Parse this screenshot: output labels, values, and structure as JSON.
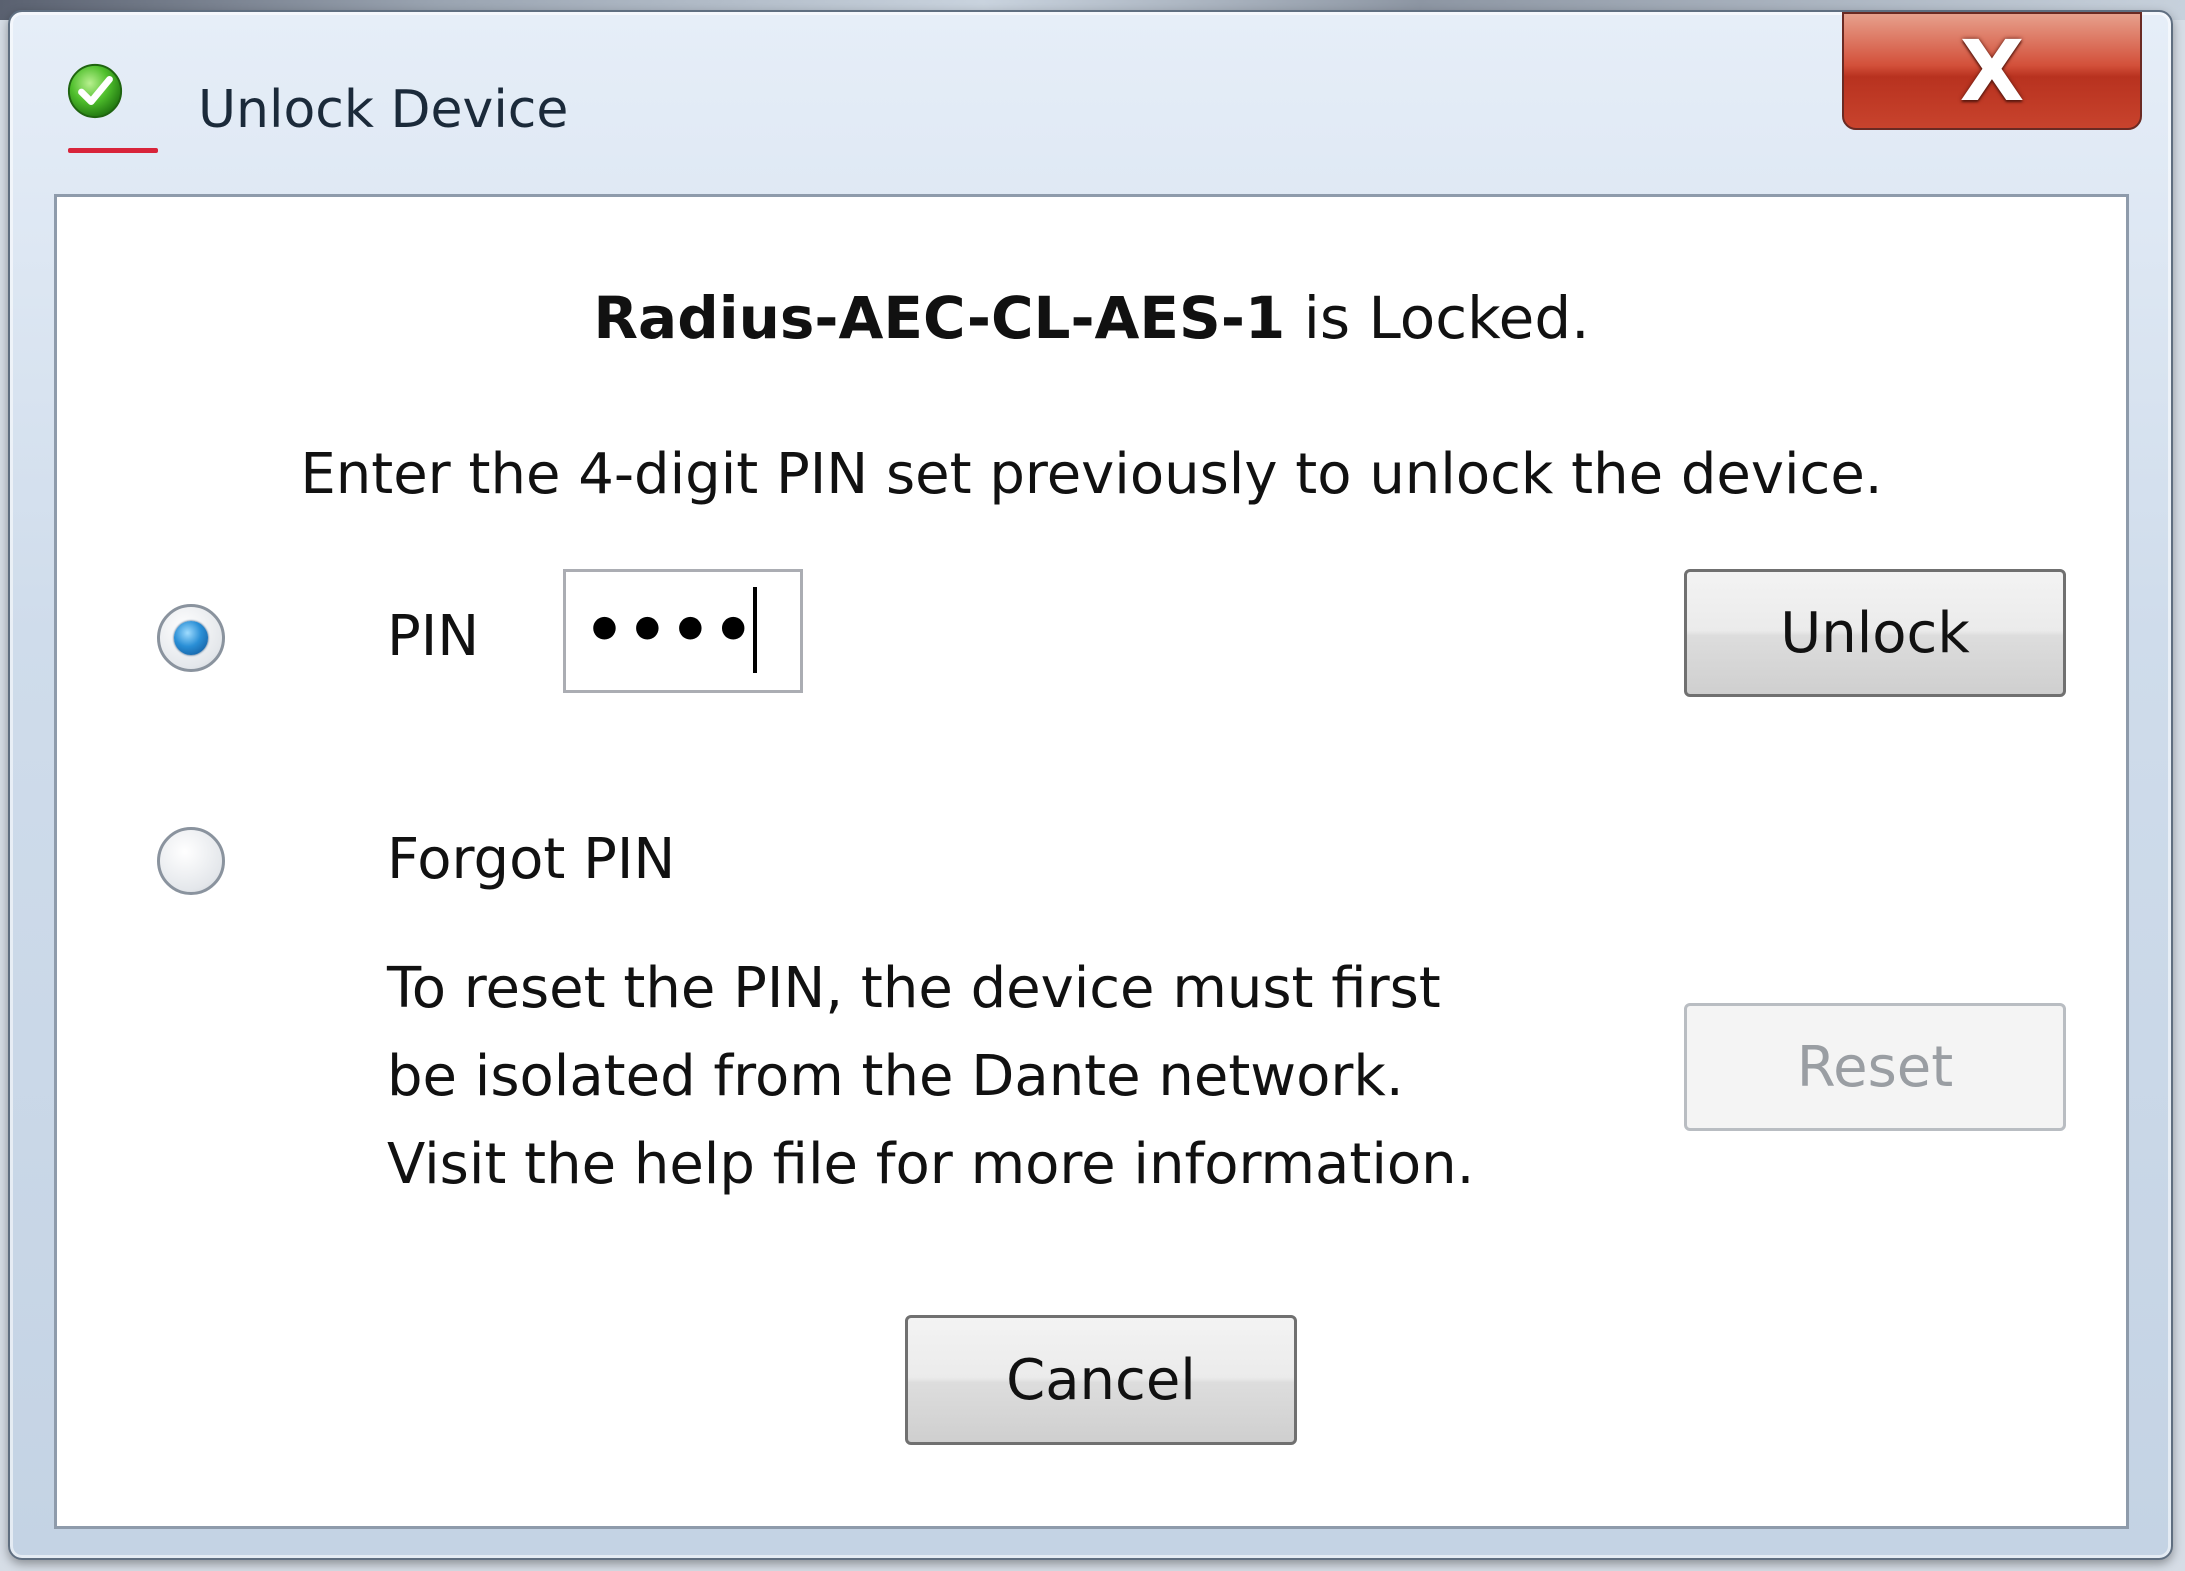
{
  "window": {
    "title": "Unlock Device",
    "close_label": "X"
  },
  "dialog": {
    "device_name": "Radius-AEC-CL-AES-1",
    "locked_suffix": " is Locked.",
    "instruction": "Enter the 4-digit PIN set previously to unlock the device.",
    "pin_option": {
      "label": "PIN",
      "selected": true,
      "masked_value": "••••"
    },
    "unlock_button": "Unlock",
    "forgot_option": {
      "label": "Forgot PIN",
      "selected": false,
      "info_lines": [
        "To reset the PIN, the device must first",
        "be isolated from the Dante network.",
        "Visit the help file for more information."
      ]
    },
    "reset_button": "Reset",
    "cancel_button": "Cancel"
  },
  "icons": {
    "app": "green-check-icon",
    "close": "close-icon"
  },
  "colors": {
    "close_button": "#c8432d",
    "radio_selected": "#2a8fd6",
    "app_icon": "#3fae2a"
  }
}
